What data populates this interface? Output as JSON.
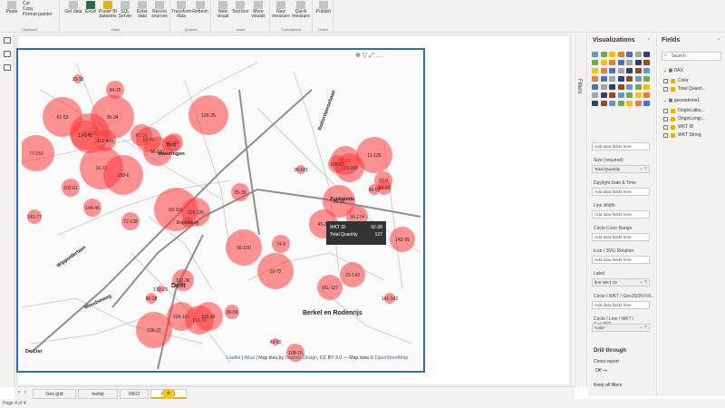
{
  "ribbon": {
    "groups": [
      {
        "label": "Clipboard",
        "buttons": [
          "Paste"
        ],
        "small": [
          "Cut",
          "Copy",
          "Format painter"
        ]
      },
      {
        "label": "Data",
        "buttons": [
          "Get data",
          "Excel",
          "Power BI datasets",
          "SQL Server",
          "Enter data",
          "Recent sources"
        ]
      },
      {
        "label": "Queries",
        "buttons": [
          "Transform data",
          "Refresh"
        ]
      },
      {
        "label": "Insert",
        "buttons": [
          "New visual",
          "Text box",
          "More visuals"
        ]
      },
      {
        "label": "Calculations",
        "buttons": [
          "New measure",
          "Quick measure"
        ]
      },
      {
        "label": "Share",
        "buttons": [
          "Publish"
        ]
      }
    ]
  },
  "map": {
    "bubbles": [
      {
        "label": "15-15"
      },
      {
        "label": "34-15"
      },
      {
        "label": "61-53"
      },
      {
        "label": "11-129"
      },
      {
        "label": "35-34"
      },
      {
        "label": "126-25"
      },
      {
        "label": "13-145"
      },
      {
        "label": "112-40b"
      },
      {
        "label": "60-38"
      },
      {
        "label": "52-46"
      },
      {
        "label": "2-181"
      },
      {
        "label": "77-152"
      },
      {
        "label": "56-137"
      },
      {
        "label": "57-31"
      },
      {
        "label": "115-105"
      },
      {
        "label": "16-72"
      },
      {
        "label": "158-6"
      },
      {
        "label": "38-161"
      },
      {
        "label": "11-125"
      },
      {
        "label": "20-9"
      },
      {
        "label": "102-61"
      },
      {
        "label": "25-39"
      },
      {
        "label": "43-60"
      },
      {
        "label": "109-57"
      },
      {
        "label": "66-57"
      },
      {
        "label": "144-46"
      },
      {
        "label": "141-77"
      },
      {
        "label": "72-138"
      },
      {
        "label": "63-116"
      },
      {
        "label": "115-126"
      },
      {
        "label": "Dupenburg"
      },
      {
        "label": "45-38"
      },
      {
        "label": "36-20"
      },
      {
        "label": "55-174"
      },
      {
        "label": "142-99"
      },
      {
        "label": "56-150"
      },
      {
        "label": "74-9"
      },
      {
        "label": "19-72"
      },
      {
        "label": "112-36"
      },
      {
        "label": "22-143"
      },
      {
        "label": "161-127"
      },
      {
        "label": "141-142"
      },
      {
        "label": "96-28"
      },
      {
        "label": "104-100"
      },
      {
        "label": "150-39"
      },
      {
        "label": "36-56"
      },
      {
        "label": "115-93"
      },
      {
        "label": "136-31"
      },
      {
        "label": "108-15"
      },
      {
        "label": "43-50"
      },
      {
        "label": "170-23"
      },
      {
        "label": "Burg"
      }
    ],
    "places": [
      "Wateringen",
      "Zuidwolde",
      "Wippolderlaan",
      "Delft",
      "Woudseweg",
      "Berkel en Rodenrijs",
      "De Lier",
      "Rotterdamsebaan"
    ],
    "tooltip": {
      "field1": "WKT ID",
      "value1": "92-38",
      "field2": "Total Quantity",
      "value2": "127"
    },
    "attribution": {
      "leaflet": "Leaflet",
      "altus": "Altus",
      "text1": " | Map tiles by ",
      "stamen": "Stamen Design",
      "text2": ", CC BY 3.0 — Map data © ",
      "osm": "OpenStreetMap"
    }
  },
  "filters_label": "Filters",
  "viz": {
    "title": "Visualizations",
    "add_fields": "Add data fields here",
    "wells": [
      {
        "label": "",
        "value": "Add data fields here",
        "filled": false
      },
      {
        "label": "Size (required)",
        "value": "Total Quantity",
        "filled": true
      },
      {
        "label": "Daylight Date & Time",
        "value": "Add data fields here",
        "filled": false
      },
      {
        "label": "Line Width",
        "value": "Add data fields here",
        "filled": false
      },
      {
        "label": "Circle Color Range",
        "value": "Add data fields here",
        "filled": false
      },
      {
        "label": "Icon / SVG Rotation",
        "value": "Add data fields here",
        "filled": false
      },
      {
        "label": "Label",
        "value": "first WKT ID",
        "filled": true
      },
      {
        "label": "Circle / WKT / GeoJSON Fill...",
        "value": "Add data fields here",
        "filled": false
      },
      {
        "label": "Circle / Line / WKT / GeoJSO...",
        "value": "Color",
        "filled": true
      }
    ],
    "drill": "Drill through",
    "cross_report": "Cross-report",
    "off": "Off",
    "keep_filters": "Keep all filters"
  },
  "fields": {
    "title": "Fields",
    "search": "Search",
    "tables": [
      {
        "name": "DAX",
        "items": [
          "Color",
          "Total Quanti..."
        ]
      },
      {
        "name": "geostations1",
        "items": [
          "OriginLatitu...",
          "OriginLongi...",
          "WKT ID",
          "WKT String"
        ]
      }
    ]
  },
  "pages": [
    "Geo grid",
    "tooltip",
    "INFO",
    "Page 1"
  ],
  "active_page": "Page 1",
  "status": "Page 4 of 4",
  "colors": {
    "accent": "#2e6db7",
    "bubble": "#ff3b3b",
    "tab_accent": "#f2c811"
  }
}
